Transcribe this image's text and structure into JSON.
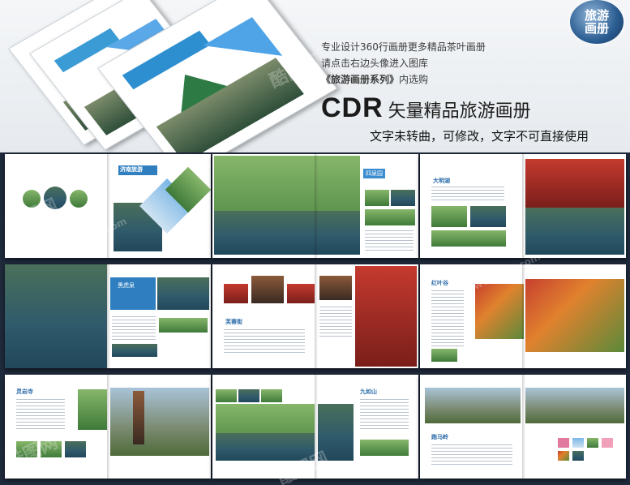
{
  "hero": {
    "line1": "专业设计360行画册更多精品茶叶画册",
    "line2": "请点击右边头像进入图库",
    "line3_series": "《旅游画册系列》",
    "line3_rest": "内选购",
    "cdr_big": "CDR",
    "cdr_rest": "矢量精品旅游画册",
    "note": "文字未转曲，可修改，文字不可直接使用",
    "badge_line1": "旅游",
    "badge_line2": "画册"
  },
  "watermarks": [
    "酷图网",
    "www.kutu.com",
    "酷图网",
    "www.kutu.com",
    "酷图网",
    "酷图网"
  ],
  "spreads": [
    {
      "name": "spread-cover",
      "tag": ""
    },
    {
      "name": "spread-willow",
      "tag": "四泉园"
    },
    {
      "name": "spread-pavilion",
      "tag": "大明湖"
    },
    {
      "name": "spread-spring",
      "tag": "黑虎泉"
    },
    {
      "name": "spread-street",
      "tag": "芙蓉街"
    },
    {
      "name": "spread-autumn",
      "tag": "红叶谷"
    },
    {
      "name": "spread-pagoda",
      "tag": "灵岩寺"
    },
    {
      "name": "spread-lake",
      "tag": "九如山"
    },
    {
      "name": "spread-mountain",
      "tag": "跑马岭"
    }
  ],
  "cover_title": "济南旅游"
}
